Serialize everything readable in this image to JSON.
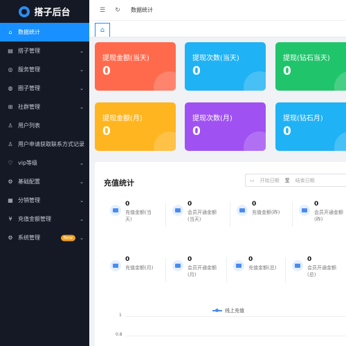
{
  "app": {
    "title": "搭子后台"
  },
  "sidebar": {
    "items": [
      {
        "label": "数据统计",
        "icon": "home-icon",
        "glyph": "⌂",
        "active": true,
        "chevron": false
      },
      {
        "label": "搭子管理",
        "icon": "folder-icon",
        "glyph": "▤",
        "chevron": true
      },
      {
        "label": "服务管理",
        "icon": "service-icon",
        "glyph": "◎",
        "chevron": true
      },
      {
        "label": "圈子管理",
        "icon": "circle-icon",
        "glyph": "◍",
        "chevron": true
      },
      {
        "label": "社群管理",
        "icon": "community-icon",
        "glyph": "⊞",
        "chevron": true
      },
      {
        "label": "用户列表",
        "icon": "user-icon",
        "glyph": "♙",
        "chevron": false
      },
      {
        "label": "用户申请获取联系方式记录",
        "icon": "user-record-icon",
        "glyph": "♙",
        "chevron": false
      },
      {
        "label": "vip等级",
        "icon": "vip-icon",
        "glyph": "♡",
        "chevron": true
      },
      {
        "label": "基础配置",
        "icon": "config-icon",
        "glyph": "⚙",
        "chevron": true
      },
      {
        "label": "分销管理",
        "icon": "distribution-icon",
        "glyph": "▦",
        "chevron": true
      },
      {
        "label": "充值金额管理",
        "icon": "yen-icon",
        "glyph": "¥",
        "chevron": true
      },
      {
        "label": "系统管理",
        "icon": "system-icon",
        "glyph": "⚙",
        "chevron": true,
        "badge": "New"
      }
    ]
  },
  "header": {
    "breadcrumb": "数据统计"
  },
  "cards": [
    {
      "title": "提现金额(当天)",
      "value": "0",
      "color": "#ff6a4d"
    },
    {
      "title": "提现次数(当天)",
      "value": "0",
      "color": "#1fb2f5"
    },
    {
      "title": "提现(钻石当天)",
      "value": "0",
      "color": "#20c56b"
    },
    {
      "title": "提现金额(月)",
      "value": "0",
      "color": "#ffb51f"
    },
    {
      "title": "提现次数(月)",
      "value": "0",
      "color": "#a051f2"
    },
    {
      "title": "提现(钻石月)",
      "value": "0",
      "color": "#1fb2f5"
    }
  ],
  "recharge": {
    "title": "充值统计",
    "date_start_placeholder": "开始日期",
    "date_sep": "至",
    "date_end_placeholder": "结束日期",
    "stats_row1": [
      {
        "value": "0",
        "label": "充值金额(当天)"
      },
      {
        "value": "0",
        "label": "会员开通金额(当天)"
      },
      {
        "value": "0",
        "label": "充值金额(昨)"
      },
      {
        "value": "0",
        "label": "会员开通金额(昨)"
      }
    ],
    "stats_row2": [
      {
        "value": "0",
        "label": "充值金额(月)"
      },
      {
        "value": "0",
        "label": "会员开通金额(月)"
      },
      {
        "value": "0",
        "label": "充值金额(总)"
      },
      {
        "value": "0",
        "label": "会员开通金额(总)"
      }
    ],
    "legend": "线上充值",
    "yticks": [
      "1",
      "0.8"
    ]
  }
}
